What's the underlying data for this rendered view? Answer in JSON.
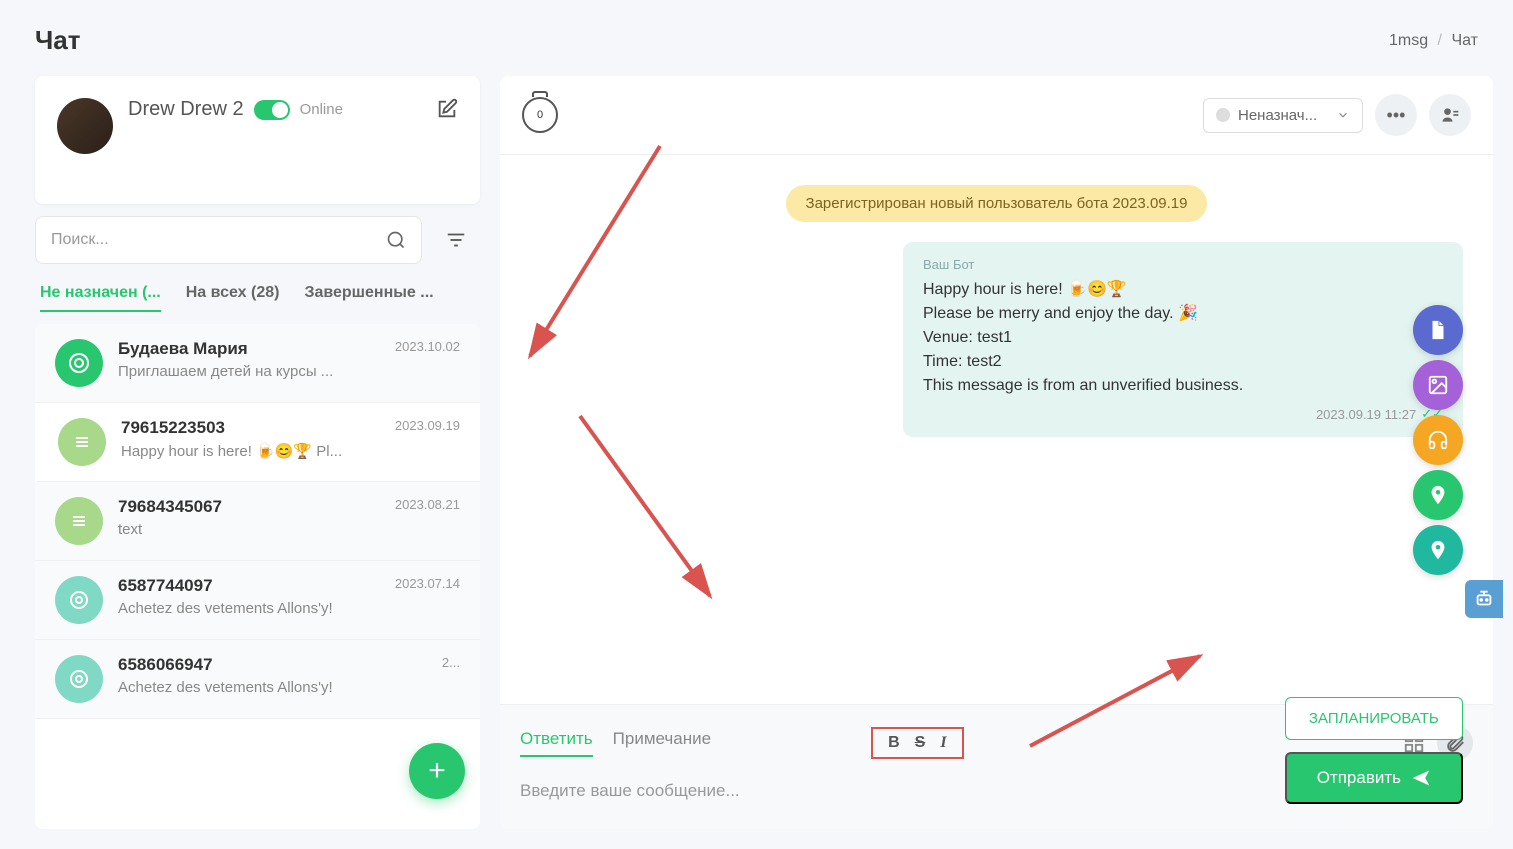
{
  "header": {
    "title": "Чат",
    "breadcrumb_root": "1msg",
    "breadcrumb_current": "Чат"
  },
  "user_card": {
    "name": "Drew Drew 2",
    "status": "Online"
  },
  "search": {
    "placeholder": "Поиск..."
  },
  "filter_tabs": {
    "unassigned": "Не назначен (...",
    "all": "На всех (28)",
    "completed": "Завершенные ..."
  },
  "chat_list": [
    {
      "name": "Будаева Мария",
      "preview": "Приглашаем детей на курсы ...",
      "date": "2023.10.02",
      "avatar": "green",
      "selected": false
    },
    {
      "name": "79615223503",
      "preview": "Happy hour is here! 🍺😊🏆 Pl...",
      "date": "2023.09.19",
      "avatar": "lightgreen",
      "selected": true
    },
    {
      "name": "79684345067",
      "preview": "text",
      "date": "2023.08.21",
      "avatar": "lightgreen",
      "selected": false
    },
    {
      "name": "6587744097",
      "preview": "Achetez des vetements Allons'y!",
      "date": "2023.07.14",
      "avatar": "teal",
      "selected": false
    },
    {
      "name": "6586066947",
      "preview": "Achetez des vetements Allons'y!",
      "date": "2...",
      "avatar": "teal",
      "selected": false
    }
  ],
  "chat_header": {
    "timer_value": "0",
    "assign_label": "Неназнач..."
  },
  "system_message": "Зарегистрирован новый пользователь бота 2023.09.19",
  "message": {
    "from": "Ваш Бот",
    "text": "Happy hour is here! 🍺😊🏆\nPlease be merry and enjoy the day. 🎉\nVenue: test1\nTime: test2\nThis message is from an unverified business.",
    "timestamp": "2023.09.19 11:27"
  },
  "composer": {
    "tab_reply": "Ответить",
    "tab_note": "Примечание",
    "placeholder": "Введите ваше сообщение...",
    "btn_schedule": "ЗАПЛАНИРОВАТЬ",
    "btn_send": "Отправить"
  }
}
